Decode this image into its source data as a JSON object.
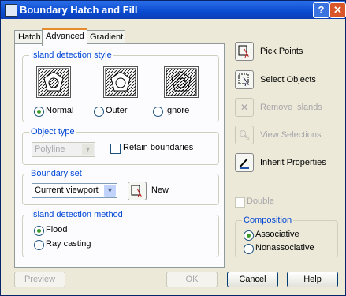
{
  "window": {
    "title": "Boundary Hatch and Fill",
    "help_glyph": "?",
    "close_glyph": "✕"
  },
  "tabs": [
    {
      "label": "Hatch"
    },
    {
      "label": "Advanced"
    },
    {
      "label": "Gradient"
    }
  ],
  "island_detection_style": {
    "label": "Island detection style",
    "options": [
      {
        "label": "Normal",
        "selected": true
      },
      {
        "label": "Outer",
        "selected": false
      },
      {
        "label": "Ignore",
        "selected": false
      }
    ]
  },
  "object_type": {
    "label": "Object type",
    "select_value": "Polyline",
    "retain_label": "Retain boundaries",
    "retain_checked": false
  },
  "boundary_set": {
    "label": "Boundary set",
    "select_value": "Current viewport",
    "new_label": "New"
  },
  "island_detection_method": {
    "label": "Island detection method",
    "options": [
      {
        "label": "Flood",
        "selected": true
      },
      {
        "label": "Ray casting",
        "selected": false
      }
    ]
  },
  "actions": [
    {
      "label": "Pick Points",
      "icon": "pick-points-icon",
      "enabled": true
    },
    {
      "label": "Select Objects",
      "icon": "select-objects-icon",
      "enabled": true
    },
    {
      "label": "Remove Islands",
      "icon": "remove-islands-icon",
      "enabled": false
    },
    {
      "label": "View Selections",
      "icon": "view-selections-icon",
      "enabled": false
    },
    {
      "label": "Inherit Properties",
      "icon": "inherit-properties-icon",
      "enabled": true
    }
  ],
  "double_label": "Double",
  "composition": {
    "label": "Composition",
    "options": [
      {
        "label": "Associative",
        "selected": true
      },
      {
        "label": "Nonassociative",
        "selected": false
      }
    ]
  },
  "footer": {
    "preview": "Preview",
    "ok": "OK",
    "cancel": "Cancel",
    "help": "Help"
  },
  "colors": {
    "title_bar": "#0a4bd0",
    "group_label": "#0046d5",
    "dialog_bg": "#ece9d8"
  }
}
